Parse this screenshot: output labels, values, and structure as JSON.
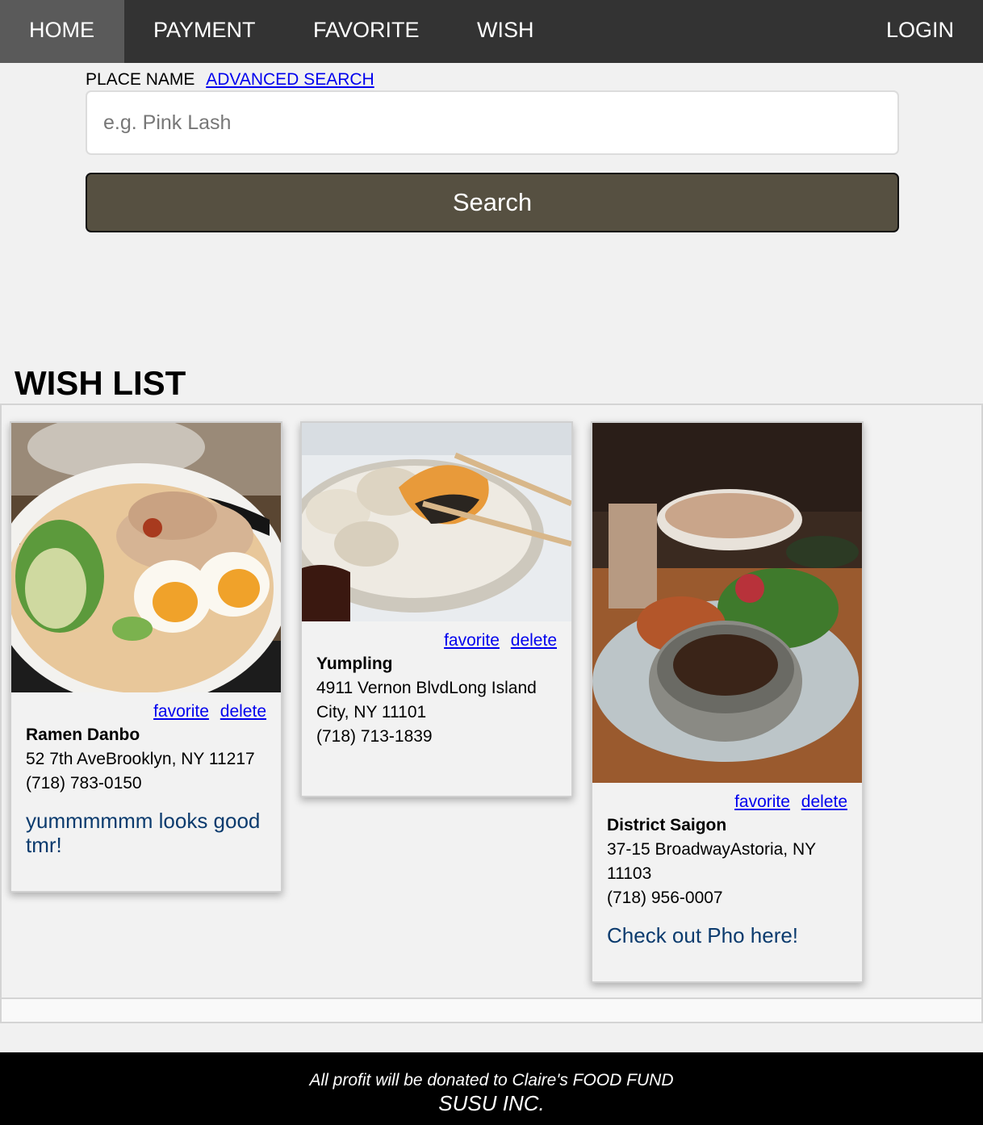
{
  "nav": {
    "home": "HOME",
    "payment": "PAYMENT",
    "favorite": "FAVORITE",
    "wish": "WISH",
    "login": "LOGIN"
  },
  "search": {
    "label": "PLACE NAME",
    "advanced_link": "ADVANCED SEARCH",
    "placeholder": "e.g. Pink Lash",
    "value": "",
    "button": "Search"
  },
  "wishlist": {
    "title": "WISH LIST",
    "favorite_label": "favorite",
    "delete_label": "delete",
    "cards": [
      {
        "name": "Ramen Danbo",
        "address": "52 7th AveBrooklyn, NY 11217",
        "phone": "(718) 783-0150",
        "note": "yummmmmm looks good tmr!",
        "photo": "ramen-photo"
      },
      {
        "name": "Yumpling",
        "address": "4911 Vernon BlvdLong Island City, NY 11101",
        "phone": "(718) 713-1839",
        "note": "",
        "photo": "dumpling-photo"
      },
      {
        "name": "District Saigon",
        "address": "37-15 BroadwayAstoria, NY 11103",
        "phone": "(718) 956-0007",
        "note": "Check out Pho here!",
        "photo": "pho-photo"
      }
    ]
  },
  "footer": {
    "line1": "All profit will be donated to Claire's FOOD FUND",
    "line2": "SUSU INC."
  },
  "colors": {
    "nav_bg": "#333333",
    "nav_active": "#5a5a5a",
    "search_button": "#565041",
    "link": "#0000ee",
    "note_text": "#0b3b6e",
    "footer_bg": "#000000"
  }
}
